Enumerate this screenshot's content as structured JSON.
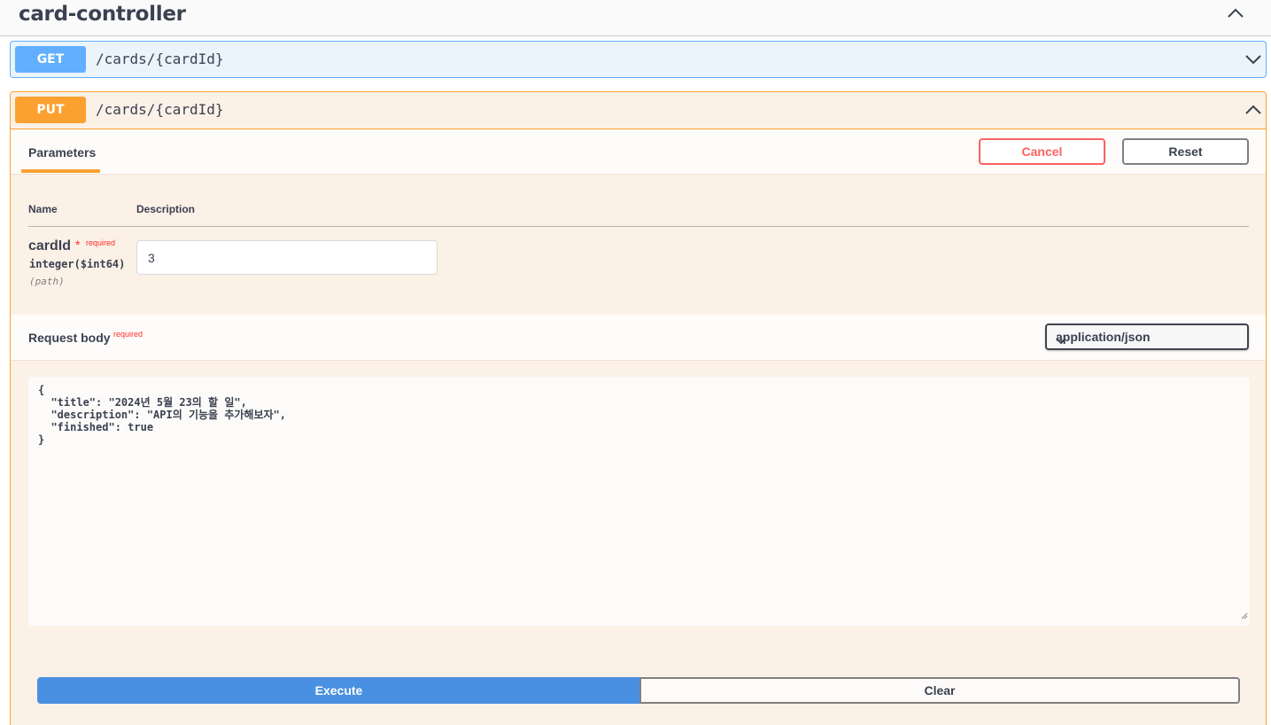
{
  "tag": {
    "title": "card-controller",
    "toggle_icon": "chevron-up-icon"
  },
  "get_endpoint": {
    "method": "GET",
    "path": "/cards/{cardId}",
    "toggle_icon": "chevron-down-icon",
    "method_color": "#61affe"
  },
  "put_endpoint": {
    "method": "PUT",
    "path": "/cards/{cardId}",
    "toggle_icon": "chevron-up-icon",
    "method_color": "#fca130",
    "tabs": {
      "parameters": "Parameters"
    },
    "cancel_label": "Cancel",
    "reset_label": "Reset",
    "columns": {
      "name": "Name",
      "description": "Description"
    },
    "parameter": {
      "name": "cardId",
      "required_star": "*",
      "required_label": "required",
      "type": "integer($int64)",
      "location": "(path)",
      "value": "3"
    },
    "request_body": {
      "title": "Request body",
      "required_label": "required",
      "content_type": "application/json",
      "body_text": "{\n  \"title\": \"2024년 5월 23의 할 일\",\n  \"description\": \"API의 기능을 추가해보자\",\n  \"finished\": true\n}"
    },
    "execute_label": "Execute",
    "clear_label": "Clear"
  },
  "colors": {
    "cancel": "#ff6060",
    "execute": "#4990e2",
    "required": "#ff2f2f"
  }
}
